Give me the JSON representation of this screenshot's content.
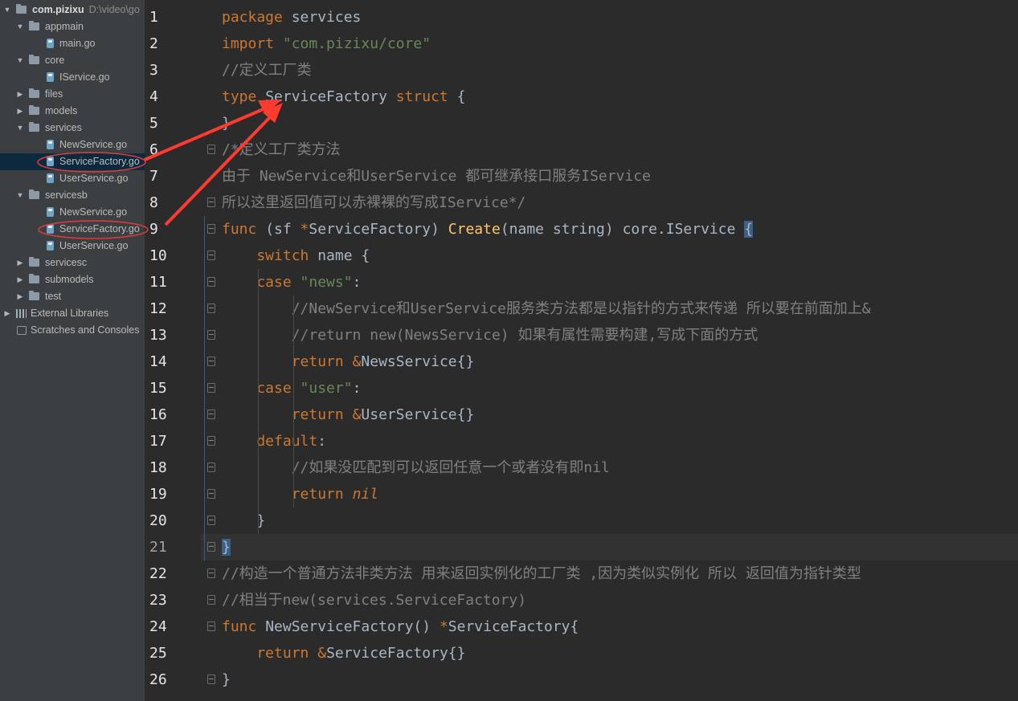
{
  "tree": {
    "items": [
      {
        "label": "com.pizixu",
        "path": "D:\\video\\go",
        "kind": "root",
        "depth": 0,
        "expanded": true
      },
      {
        "label": "appmain",
        "kind": "folder",
        "depth": 1,
        "expanded": true
      },
      {
        "label": "main.go",
        "kind": "go",
        "depth": 2
      },
      {
        "label": "core",
        "kind": "folder",
        "depth": 1,
        "expanded": true
      },
      {
        "label": "IService.go",
        "kind": "go",
        "depth": 2
      },
      {
        "label": "files",
        "kind": "folder",
        "depth": 1,
        "expanded": false
      },
      {
        "label": "models",
        "kind": "folder",
        "depth": 1,
        "expanded": false
      },
      {
        "label": "services",
        "kind": "folder",
        "depth": 1,
        "expanded": true
      },
      {
        "label": "NewService.go",
        "kind": "go",
        "depth": 2
      },
      {
        "label": "ServiceFactory.go",
        "kind": "go",
        "depth": 2,
        "selected": true,
        "circled": true
      },
      {
        "label": "UserService.go",
        "kind": "go",
        "depth": 2
      },
      {
        "label": "servicesb",
        "kind": "folder",
        "depth": 1,
        "expanded": true
      },
      {
        "label": "NewService.go",
        "kind": "go",
        "depth": 2
      },
      {
        "label": "ServiceFactory.go",
        "kind": "go",
        "depth": 2,
        "circled": true
      },
      {
        "label": "UserService.go",
        "kind": "go",
        "depth": 2
      },
      {
        "label": "servicesc",
        "kind": "folder",
        "depth": 1,
        "expanded": false
      },
      {
        "label": "submodels",
        "kind": "folder",
        "depth": 1,
        "expanded": false
      },
      {
        "label": "test",
        "kind": "folder",
        "depth": 1,
        "expanded": false
      },
      {
        "label": "External Libraries",
        "kind": "lib",
        "depth": 0,
        "expanded": false
      },
      {
        "label": "Scratches and Consoles",
        "kind": "scratch",
        "depth": 0
      }
    ]
  },
  "editor": {
    "current_line": 21,
    "colors": {
      "keyword": "#cc7832",
      "text": "#a9b7c6",
      "comment": "#808080",
      "string": "#6a8759",
      "function": "#ffc66d",
      "type": "#a9b7c6",
      "bracket_highlight": "#3b5f87",
      "annotation": "#ff3b30"
    },
    "lines": [
      {
        "n": "1",
        "tokens": [
          {
            "t": "package ",
            "c": "kw"
          },
          {
            "t": "services",
            "c": "plain"
          }
        ]
      },
      {
        "n": "2",
        "tokens": [
          {
            "t": "import ",
            "c": "kw"
          },
          {
            "t": "\"com.pizixu/core\"",
            "c": "str"
          }
        ]
      },
      {
        "n": "3",
        "tokens": [
          {
            "t": "//定义工厂类",
            "c": "cm"
          }
        ]
      },
      {
        "n": "4",
        "tokens": [
          {
            "t": "type ",
            "c": "kw"
          },
          {
            "t": "ServiceFactory ",
            "c": "plain"
          },
          {
            "t": "struct ",
            "c": "kw"
          },
          {
            "t": "{",
            "c": "plain"
          }
        ]
      },
      {
        "n": "5",
        "tokens": [
          {
            "t": "}",
            "c": "plain"
          }
        ]
      },
      {
        "n": "6",
        "tokens": [
          {
            "t": "/*定义工厂类方法",
            "c": "cm"
          }
        ]
      },
      {
        "n": "7",
        "tokens": [
          {
            "t": "由于 NewService和UserService 都可继承接口服务IService",
            "c": "cm"
          }
        ]
      },
      {
        "n": "8",
        "tokens": [
          {
            "t": "所以这里返回值可以赤裸裸的写成IService*/",
            "c": "cm"
          }
        ]
      },
      {
        "n": "9",
        "tokens": [
          {
            "t": "func ",
            "c": "kw"
          },
          {
            "t": "(sf ",
            "c": "plain"
          },
          {
            "t": "*",
            "c": "kw"
          },
          {
            "t": "ServiceFactory",
            "c": "type"
          },
          {
            "t": ") ",
            "c": "plain"
          },
          {
            "t": "Create",
            "c": "fn"
          },
          {
            "t": "(name ",
            "c": "plain"
          },
          {
            "t": "string",
            "c": "type"
          },
          {
            "t": ") core.",
            "c": "plain"
          },
          {
            "t": "IService",
            "c": "type"
          },
          {
            "t": " ",
            "c": "plain"
          },
          {
            "t": "{",
            "c": "brace"
          }
        ]
      },
      {
        "n": "10",
        "tokens": [
          {
            "t": "    switch ",
            "c": "kw"
          },
          {
            "t": "name {",
            "c": "plain"
          }
        ]
      },
      {
        "n": "11",
        "tokens": [
          {
            "t": "    case ",
            "c": "kw"
          },
          {
            "t": "\"news\"",
            "c": "str"
          },
          {
            "t": ":",
            "c": "plain"
          }
        ]
      },
      {
        "n": "12",
        "tokens": [
          {
            "t": "        //NewService和UserService服务类方法都是以指针的方式来传递 所以要在前面加上&",
            "c": "cm"
          }
        ]
      },
      {
        "n": "13",
        "tokens": [
          {
            "t": "        //return new(NewsService) 如果有属性需要构建,写成下面的方式",
            "c": "cm"
          }
        ]
      },
      {
        "n": "14",
        "tokens": [
          {
            "t": "        return ",
            "c": "kw"
          },
          {
            "t": "&",
            "c": "kw"
          },
          {
            "t": "NewsService",
            "c": "type"
          },
          {
            "t": "{}",
            "c": "plain"
          }
        ]
      },
      {
        "n": "15",
        "tokens": [
          {
            "t": "    case ",
            "c": "kw"
          },
          {
            "t": "\"user\"",
            "c": "str"
          },
          {
            "t": ":",
            "c": "plain"
          }
        ]
      },
      {
        "n": "16",
        "tokens": [
          {
            "t": "        return ",
            "c": "kw"
          },
          {
            "t": "&",
            "c": "kw"
          },
          {
            "t": "UserService",
            "c": "type"
          },
          {
            "t": "{}",
            "c": "plain"
          }
        ]
      },
      {
        "n": "17",
        "tokens": [
          {
            "t": "    default",
            "c": "kw"
          },
          {
            "t": ":",
            "c": "plain"
          }
        ]
      },
      {
        "n": "18",
        "tokens": [
          {
            "t": "        //如果没匹配到可以返回任意一个或者没有即nil",
            "c": "cm"
          }
        ]
      },
      {
        "n": "19",
        "tokens": [
          {
            "t": "        return ",
            "c": "kw"
          },
          {
            "t": "nil",
            "c": "kwi"
          }
        ]
      },
      {
        "n": "20",
        "tokens": [
          {
            "t": "    }",
            "c": "plain"
          }
        ]
      },
      {
        "n": "21",
        "tokens": [
          {
            "t": "}",
            "c": "brace"
          }
        ]
      },
      {
        "n": "22",
        "tokens": [
          {
            "t": "//构造一个普通方法非类方法 用来返回实例化的工厂类 ,因为类似实例化 所以 返回值为指针类型",
            "c": "cm"
          }
        ]
      },
      {
        "n": "23",
        "tokens": [
          {
            "t": "//相当于new(services.ServiceFactory)",
            "c": "cm"
          }
        ]
      },
      {
        "n": "24",
        "tokens": [
          {
            "t": "func ",
            "c": "kw"
          },
          {
            "t": "NewServiceFactory",
            "c": "type"
          },
          {
            "t": "() ",
            "c": "plain"
          },
          {
            "t": "*",
            "c": "kw"
          },
          {
            "t": "ServiceFactory",
            "c": "type"
          },
          {
            "t": "{",
            "c": "plain"
          }
        ]
      },
      {
        "n": "25",
        "tokens": [
          {
            "t": "    return ",
            "c": "kw"
          },
          {
            "t": "&",
            "c": "kw"
          },
          {
            "t": "ServiceFactory",
            "c": "type"
          },
          {
            "t": "{}",
            "c": "plain"
          }
        ]
      },
      {
        "n": "26",
        "tokens": [
          {
            "t": "}",
            "c": "plain"
          }
        ]
      }
    ]
  }
}
